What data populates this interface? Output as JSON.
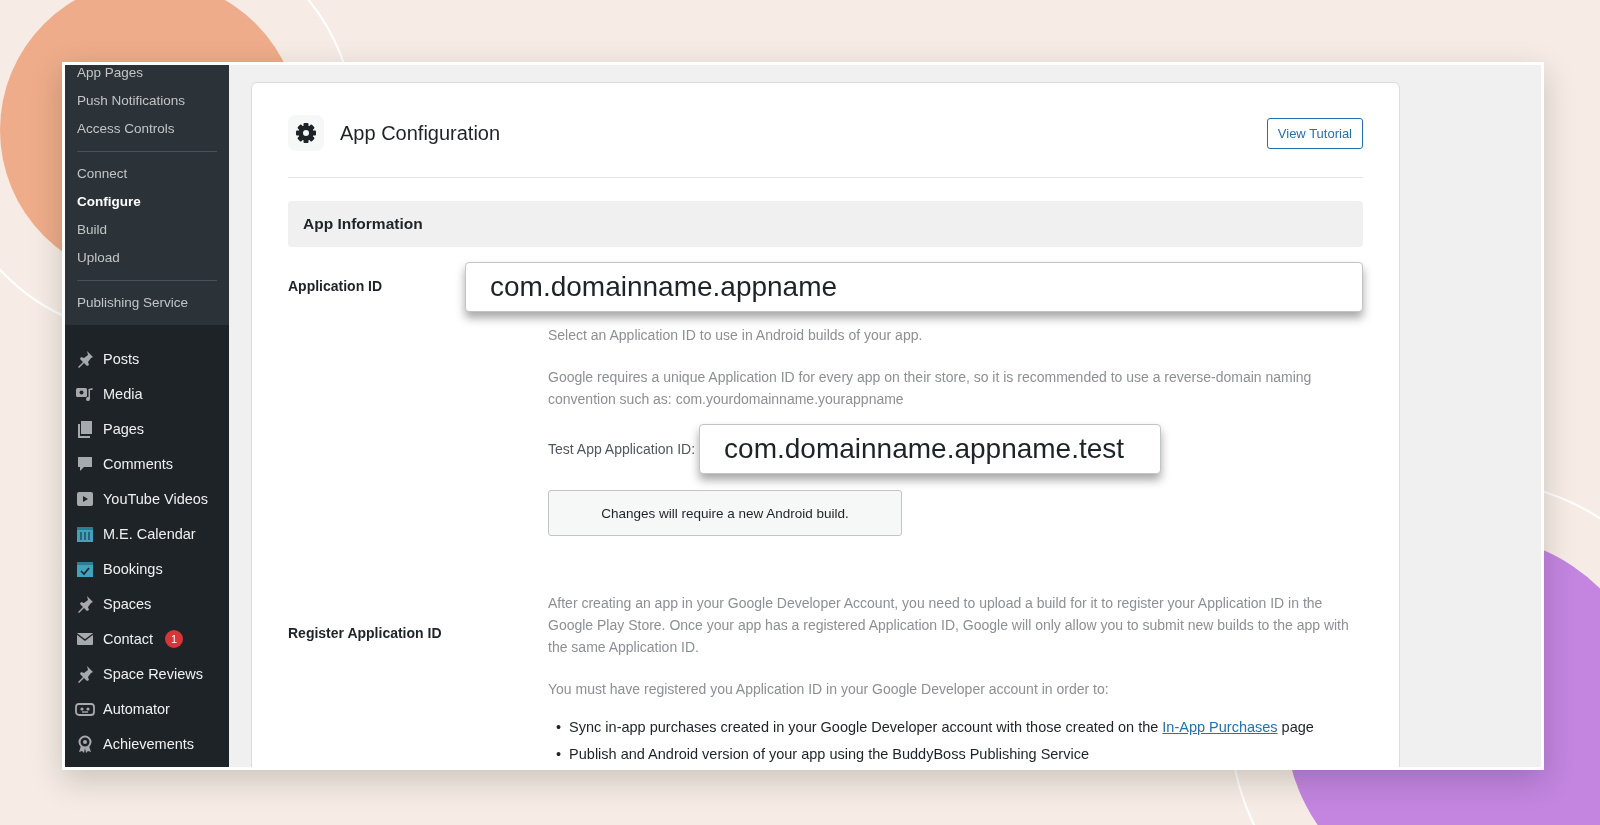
{
  "sidebar": {
    "submenu_groups": [
      {
        "items": [
          {
            "label": "App Pages",
            "selected": false
          },
          {
            "label": "Push Notifications",
            "selected": false
          },
          {
            "label": "Access Controls",
            "selected": false
          }
        ]
      },
      {
        "items": [
          {
            "label": "Connect",
            "selected": false
          },
          {
            "label": "Configure",
            "selected": true
          },
          {
            "label": "Build",
            "selected": false
          },
          {
            "label": "Upload",
            "selected": false
          }
        ]
      },
      {
        "items": [
          {
            "label": "Publishing Service",
            "selected": false
          }
        ]
      }
    ],
    "menu": [
      {
        "label": "Posts"
      },
      {
        "label": "Media"
      },
      {
        "label": "Pages"
      },
      {
        "label": "Comments"
      },
      {
        "label": "YouTube Videos"
      },
      {
        "label": "M.E. Calendar"
      },
      {
        "label": "Bookings"
      },
      {
        "label": "Spaces"
      },
      {
        "label": "Contact",
        "badge": "1"
      },
      {
        "label": "Space Reviews"
      },
      {
        "label": "Automator"
      },
      {
        "label": "Achievements"
      }
    ]
  },
  "page": {
    "title": "App Configuration",
    "tutorial_button": "View Tutorial",
    "section": "App Information",
    "application_id": {
      "label": "Application ID",
      "value": "com.domainname.appname",
      "help": [
        "Select an Application ID to use in Android builds of your app.",
        "Google requires a unique Application ID for every app on their store, so it is recommended to use a reverse-domain naming convention such as: com.yourdomainname.yourappname"
      ],
      "test_label": "Test App Application ID:",
      "test_value": "com.domainname.appname.test",
      "notice": "Changes will require a new Android build."
    },
    "register": {
      "label": "Register Application ID",
      "paragraphs": [
        "After creating an app in your Google Developer Account, you need to upload a build for it to register your Application ID in the Google Play Store. Once your app has a registered Application ID, Google will only allow you to submit new builds to the app with the same Application ID.",
        "You must have registered you Application ID in your Google Developer account in order to:"
      ],
      "bullets": [
        {
          "marker": "•",
          "text": "Sync in-app purchases created in your Google Developer account with those created on the",
          "link": "In-App Purchases",
          "after": "page"
        },
        {
          "marker": "•",
          "text": "Publish and Android version of your app using the BuddyBoss Publishing Service"
        }
      ]
    }
  }
}
